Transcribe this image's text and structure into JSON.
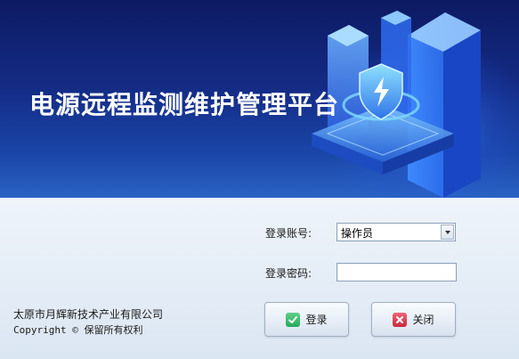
{
  "app": {
    "title": "电源远程监测维护管理平台"
  },
  "form": {
    "account_label": "登录账号:",
    "account_value": "操作员",
    "password_label": "登录密码:",
    "password_value": ""
  },
  "buttons": {
    "login_label": "登录",
    "close_label": "关闭"
  },
  "footer": {
    "company": "太原市月辉新技术产业有限公司",
    "copyright": "Copyright © 保留所有权利"
  },
  "colors": {
    "banner_dark": "#0d1a63",
    "banner_light": "#2a63c4",
    "login_icon": "#25a85a",
    "close_icon": "#c9283e"
  },
  "icons": {
    "login": "check-icon",
    "close": "close-x-icon",
    "dropdown": "chevron-down-icon",
    "illustration": "shield-lightning-icon"
  }
}
